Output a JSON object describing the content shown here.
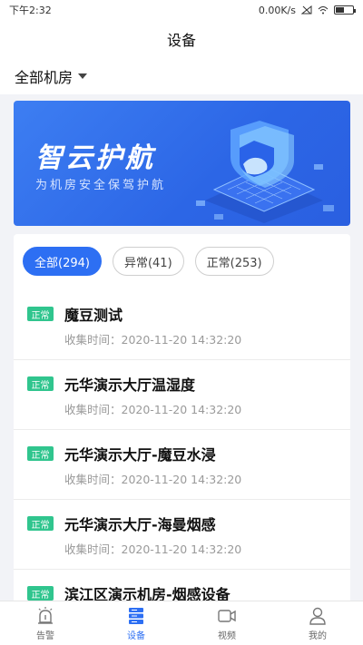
{
  "status": {
    "time": "下午2:32",
    "net": "0.00K/s"
  },
  "header": {
    "title": "设备"
  },
  "room_selector": {
    "label": "全部机房"
  },
  "banner": {
    "title": "智云护航",
    "subtitle": "为机房安全保驾护航"
  },
  "filters": [
    {
      "label": "全部(294)",
      "active": true
    },
    {
      "label": "异常(41)",
      "active": false
    },
    {
      "label": "正常(253)",
      "active": false
    }
  ],
  "devices": [
    {
      "status": "正常",
      "name": "魔豆测试",
      "time": "收集时间：2020-11-20 14:32:20"
    },
    {
      "status": "正常",
      "name": "元华演示大厅温湿度",
      "time": "收集时间：2020-11-20 14:32:20"
    },
    {
      "status": "正常",
      "name": "元华演示大厅-魔豆水浸",
      "time": "收集时间：2020-11-20 14:32:20"
    },
    {
      "status": "正常",
      "name": "元华演示大厅-海曼烟感",
      "time": "收集时间：2020-11-20 14:32:20"
    },
    {
      "status": "正常",
      "name": "滨江区演示机房-烟感设备",
      "time": ""
    }
  ],
  "tabs": [
    {
      "label": "告警",
      "icon": "alarm-icon"
    },
    {
      "label": "设备",
      "icon": "server-icon"
    },
    {
      "label": "视频",
      "icon": "video-camera-icon"
    },
    {
      "label": "我的",
      "icon": "user-icon"
    }
  ],
  "colors": {
    "accent": "#2d6ff3",
    "ok": "#30c58e"
  }
}
